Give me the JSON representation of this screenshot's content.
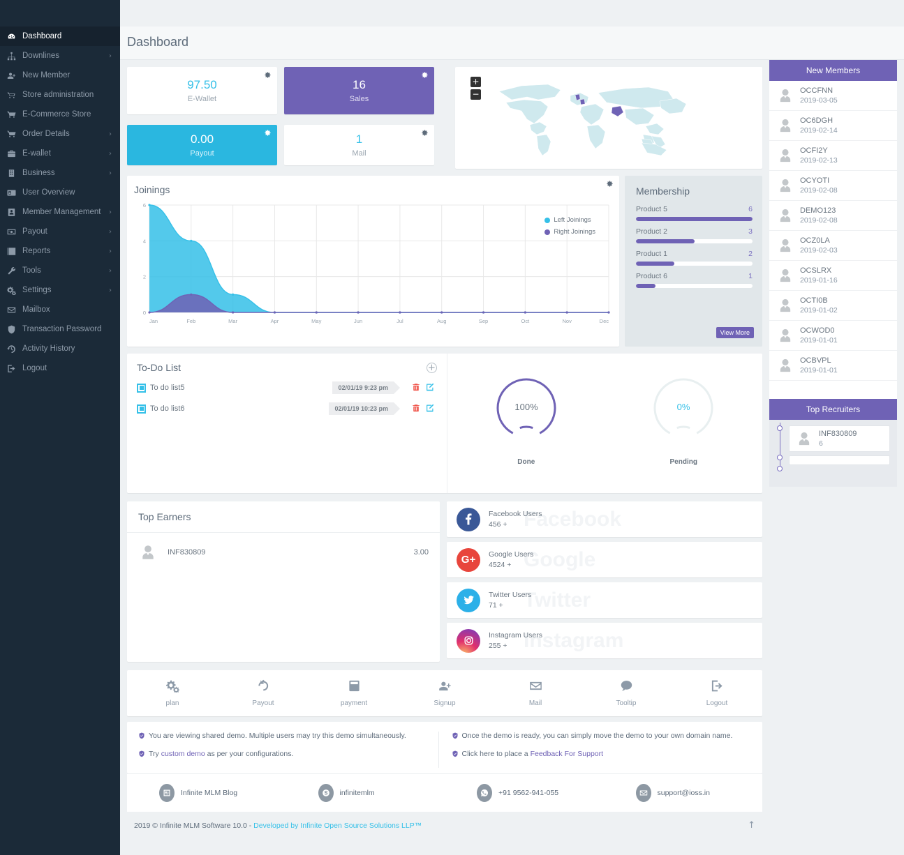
{
  "sidebar": {
    "items": [
      {
        "label": "Dashboard",
        "icon": "dashboard-icon",
        "active": true,
        "caret": false
      },
      {
        "label": "Downlines",
        "icon": "sitemap-icon",
        "active": false,
        "caret": true
      },
      {
        "label": "New Member",
        "icon": "user-plus-icon",
        "active": false,
        "caret": false
      },
      {
        "label": "Store administration",
        "icon": "cart-outline-icon",
        "active": false,
        "caret": false
      },
      {
        "label": "E-Commerce Store",
        "icon": "cart-icon",
        "active": false,
        "caret": false
      },
      {
        "label": "Order Details",
        "icon": "cart-icon",
        "active": false,
        "caret": true
      },
      {
        "label": "E-wallet",
        "icon": "briefcase-icon",
        "active": false,
        "caret": true
      },
      {
        "label": "Business",
        "icon": "building-icon",
        "active": false,
        "caret": true
      },
      {
        "label": "User Overview",
        "icon": "id-card-icon",
        "active": false,
        "caret": false
      },
      {
        "label": "Member Management",
        "icon": "user-badge-icon",
        "active": false,
        "caret": true
      },
      {
        "label": "Payout",
        "icon": "money-icon",
        "active": false,
        "caret": true
      },
      {
        "label": "Reports",
        "icon": "bar-chart-icon",
        "active": false,
        "caret": true
      },
      {
        "label": "Tools",
        "icon": "wrench-icon",
        "active": false,
        "caret": true
      },
      {
        "label": "Settings",
        "icon": "gears-icon",
        "active": false,
        "caret": true
      },
      {
        "label": "Mailbox",
        "icon": "envelope-icon",
        "active": false,
        "caret": false
      },
      {
        "label": "Transaction Password",
        "icon": "shield-icon",
        "active": false,
        "caret": false
      },
      {
        "label": "Activity History",
        "icon": "history-icon",
        "active": false,
        "caret": false
      },
      {
        "label": "Logout",
        "icon": "logout-icon",
        "active": false,
        "caret": false
      }
    ]
  },
  "header": {
    "title": "Dashboard"
  },
  "stats": [
    {
      "value": "97.50",
      "label": "E-Wallet",
      "style": "white"
    },
    {
      "value": "16",
      "label": "Sales",
      "style": "purple"
    },
    {
      "value": "0.00",
      "label": "Payout",
      "style": "cyan"
    },
    {
      "value": "1",
      "label": "Mail",
      "style": "white"
    }
  ],
  "map": {
    "zoom_in": "+",
    "zoom_out": "−"
  },
  "chart_data": {
    "type": "area",
    "title": "Joinings",
    "categories": [
      "Jan",
      "Feb",
      "Mar",
      "Apr",
      "May",
      "Jun",
      "Jul",
      "Aug",
      "Sep",
      "Oct",
      "Nov",
      "Dec"
    ],
    "series": [
      {
        "name": "Left Joinings",
        "color": "#35c0e8",
        "values": [
          6,
          4,
          1,
          0,
          0,
          0,
          0,
          0,
          0,
          0,
          0,
          0
        ]
      },
      {
        "name": "Right Joinings",
        "color": "#6f62b5",
        "values": [
          0,
          1,
          0,
          0,
          0,
          0,
          0,
          0,
          0,
          0,
          0,
          0
        ]
      }
    ],
    "xlabel": "",
    "ylabel": "",
    "ylim": [
      0,
      6
    ],
    "yticks": [
      "0",
      "2",
      "4",
      "6"
    ],
    "grid": true,
    "legend_position": "top-right"
  },
  "membership": {
    "title": "Membership",
    "items": [
      {
        "name": "Product 5",
        "count": "6",
        "percent": 100
      },
      {
        "name": "Product 2",
        "count": "3",
        "percent": 50
      },
      {
        "name": "Product 1",
        "count": "2",
        "percent": 33
      },
      {
        "name": "Product 6",
        "count": "1",
        "percent": 17
      }
    ],
    "view_more": "View More"
  },
  "todo": {
    "title": "To-Do List",
    "items": [
      {
        "text": "To do list5",
        "date": "02/01/19 9:23 pm"
      },
      {
        "text": "To do list6",
        "date": "02/01/19 10:23 pm"
      }
    ],
    "gauges": [
      {
        "value": "100%",
        "label": "Done",
        "percent": 100,
        "color": "#6f62b5"
      },
      {
        "value": "0%",
        "label": "Pending",
        "percent": 0,
        "color": "#e8eff0"
      }
    ]
  },
  "earners": {
    "title": "Top Earners",
    "items": [
      {
        "name": "INF830809",
        "amount": "3.00"
      }
    ]
  },
  "social": [
    {
      "name": "Facebook Users",
      "count": "456 +",
      "ghost": "Facebook",
      "glyph": "f",
      "color": "#3a5897"
    },
    {
      "name": "Google Users",
      "count": "4524 +",
      "ghost": "Google",
      "glyph": "G+",
      "color": "#e8453c"
    },
    {
      "name": "Twitter Users",
      "count": "71 +",
      "ghost": "Twitter",
      "glyph": "t",
      "color": "#2cb0e8"
    },
    {
      "name": "Instagram Users",
      "count": "255 +",
      "ghost": "Instagram",
      "glyph": "ig",
      "color": "#d62976"
    }
  ],
  "quicklinks": [
    {
      "label": "plan",
      "icon": "gears-icon"
    },
    {
      "label": "Payout",
      "icon": "undo-icon"
    },
    {
      "label": "payment",
      "icon": "card-icon"
    },
    {
      "label": "Signup",
      "icon": "user-plus-icon"
    },
    {
      "label": "Mail",
      "icon": "envelope-icon"
    },
    {
      "label": "Tooltip",
      "icon": "comment-icon"
    },
    {
      "label": "Logout",
      "icon": "logout-icon"
    }
  ],
  "notices": {
    "left": [
      {
        "pre": "You are viewing shared demo. Multiple users may try this demo simultaneously.",
        "link": "",
        "post": ""
      },
      {
        "pre": "Try ",
        "link": "custom demo",
        "post": " as per your configurations."
      }
    ],
    "right": [
      {
        "pre": "Once the demo is ready, you can simply move the demo to your own domain name.",
        "link": "",
        "post": ""
      },
      {
        "pre": "Click here to place a ",
        "link": "Feedback For Support",
        "post": ""
      }
    ]
  },
  "contacts": [
    {
      "text": "Infinite MLM Blog",
      "icon": "blog-icon"
    },
    {
      "text": "infinitemlm",
      "icon": "skype-icon"
    },
    {
      "text": "+91 9562-941-055",
      "icon": "whatsapp-icon"
    },
    {
      "text": "support@ioss.in",
      "icon": "envelope-icon"
    }
  ],
  "footer": {
    "copyright": "2019 © Infinite MLM Software 10.0 - ",
    "link": "Developed by Infinite Open Source Solutions LLP™",
    "to_top": "↑"
  },
  "new_members": {
    "title": "New Members",
    "items": [
      {
        "id": "OCCFNN",
        "date": "2019-03-05"
      },
      {
        "id": "OC6DGH",
        "date": "2019-02-14"
      },
      {
        "id": "OCFI2Y",
        "date": "2019-02-13"
      },
      {
        "id": "OCYOTI",
        "date": "2019-02-08"
      },
      {
        "id": "DEMO123",
        "date": "2019-02-08"
      },
      {
        "id": "OCZ0LA",
        "date": "2019-02-03"
      },
      {
        "id": "OCSLRX",
        "date": "2019-01-16"
      },
      {
        "id": "OCTI0B",
        "date": "2019-01-02"
      },
      {
        "id": "OCWOD0",
        "date": "2019-01-01"
      },
      {
        "id": "OCBVPL",
        "date": "2019-01-01"
      }
    ]
  },
  "top_recruiters": {
    "title": "Top Recruiters",
    "items": [
      {
        "id": "INF830809",
        "count": "6"
      }
    ]
  }
}
